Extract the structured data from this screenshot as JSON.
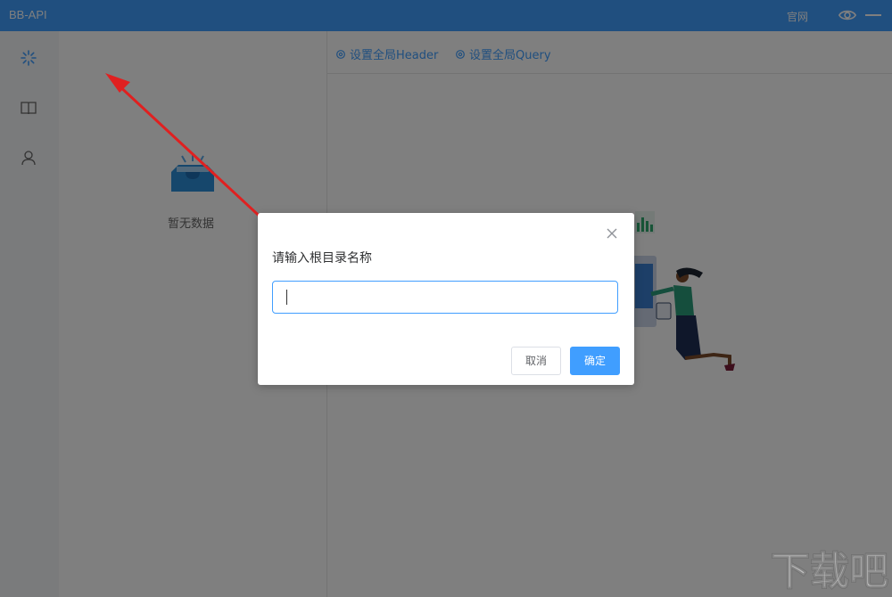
{
  "app": {
    "title": "BB-API",
    "official_site": "官网"
  },
  "toolbar": {
    "set_header": "设置全局Header",
    "set_query": "设置全局Query"
  },
  "tree": {
    "empty_text": "暂无数据"
  },
  "dialog": {
    "title": "请输入根目录名称",
    "input_value": "",
    "cancel_label": "取消",
    "ok_label": "确定"
  },
  "watermark": {
    "text": "下载吧"
  },
  "colors": {
    "primary": "#409eff",
    "overlay": "rgba(0,0,0,0.5)",
    "arrow": "#e02020"
  },
  "icons": {
    "sidebar": [
      "loading-icon",
      "book-icon",
      "user-icon"
    ],
    "toolbar": [
      "plus-icon",
      "refresh-icon",
      "share-icon",
      "gear-icon"
    ]
  }
}
